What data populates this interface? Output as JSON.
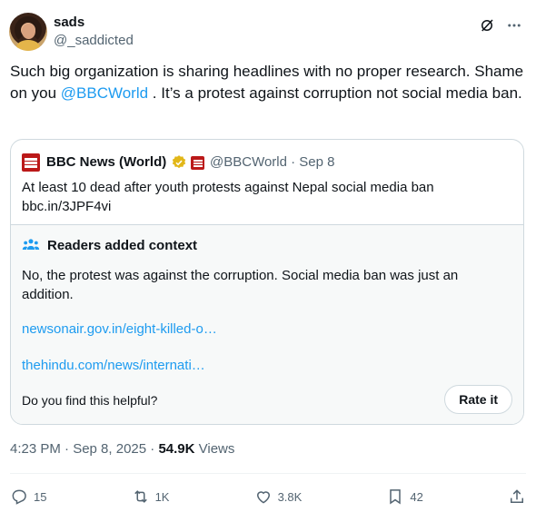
{
  "author": {
    "name": "sads",
    "handle": "@_saddicted"
  },
  "tweet": {
    "text_before": "Such big organization is sharing headlines with no proper research. Shame on you ",
    "mention": "@BBCWorld",
    "text_after": " . It’s a protest against corruption not social media ban."
  },
  "quote": {
    "name": "BBC News (World)",
    "meta": "@BBCWorld · Sep 8",
    "text_line1": "At least 10 dead after youth protests against Nepal social media ban",
    "text_line2": "bbc.in/3JPF4vi"
  },
  "context": {
    "title": "Readers added context",
    "body": "No, the protest was against the corruption. Social media ban was just an addition.",
    "link1": "newsonair.gov.in/eight-killed-o…",
    "link2": "thehindu.com/news/internati…",
    "helpful_question": "Do you find this helpful?",
    "rate_label": "Rate it"
  },
  "meta": {
    "time": "4:23 PM · Sep 8, 2025 · ",
    "views_count": "54.9K",
    "views_label": " Views"
  },
  "actions": {
    "replies": "15",
    "reposts": "1K",
    "likes": "3.8K",
    "bookmarks": "42"
  },
  "colors": {
    "accent": "#1d9bf0",
    "bbc_red": "#bb1919",
    "verified_gold": "#e2b719"
  }
}
